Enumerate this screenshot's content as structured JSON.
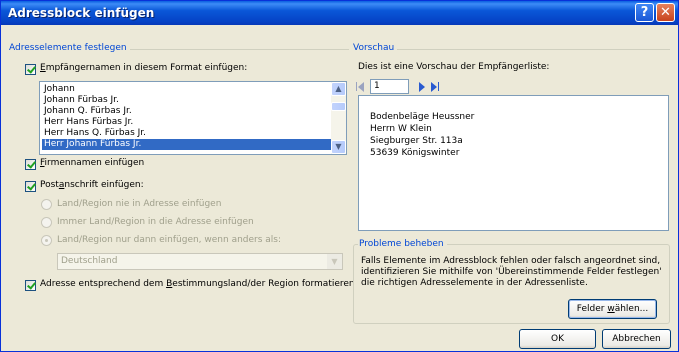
{
  "window": {
    "title": "Adressblock einfügen",
    "help_glyph": "?",
    "close_glyph": "✕"
  },
  "left": {
    "group_title": "Adresselemente festlegen",
    "recipient_checkbox": {
      "checked": true,
      "pre": "E",
      "label": "mpfängernamen in diesem Format einfügen:"
    },
    "name_formats": [
      "Johann",
      "Johann Fürbas Jr.",
      "Johann Q. Fürbas Jr.",
      "Herr Hans Fürbas Jr.",
      "Herr Hans Q. Fürbas Jr.",
      "Herr Johann Fürbas Jr."
    ],
    "selected_format_index": 5,
    "company_checkbox": {
      "checked": true,
      "pre": "F",
      "label": "irmennamen einfügen"
    },
    "postal_checkbox": {
      "checked": true,
      "pre": "Post",
      "u": "a",
      "label": "nschrift einfügen:"
    },
    "radios": [
      {
        "label": "Land/Region nie in Adresse einfügen",
        "selected": false
      },
      {
        "label": "Immer Land/Region in die Adresse einfügen",
        "selected": false
      },
      {
        "label": "Land/Region nur dann einfügen, wenn anders als:",
        "selected": true
      }
    ],
    "country": "Deutschland",
    "format_checkbox": {
      "checked": true,
      "pre": "Adresse entsprechend dem ",
      "u": "B",
      "label": "estimmungsland/der Region formatieren"
    }
  },
  "right": {
    "group_title": "Vorschau",
    "preview_intro": "Dies ist eine Vorschau der Empfängerliste:",
    "record_number": "1",
    "preview_lines": [
      "Bodenbeläge Heussner",
      "Herrn W Klein",
      "Siegburger Str. 113a",
      "53639 Königswinter"
    ],
    "problems_title": "Probleme beheben",
    "problems_text": "Falls Elemente im Adressblock fehlen oder falsch angeordnet sind, identifizieren Sie mithilfe von 'Übereinstimmende Felder festlegen' die richtigen Adresselemente in der Adressenliste.",
    "match_button": {
      "pre": "Felder ",
      "u": "w",
      "post": "ählen..."
    }
  },
  "buttons": {
    "ok": "OK",
    "cancel": "Abbrechen"
  },
  "colors": {
    "titlebar": "#0a57d8",
    "group_title": "#0046d5",
    "selection": "#316ac5"
  }
}
